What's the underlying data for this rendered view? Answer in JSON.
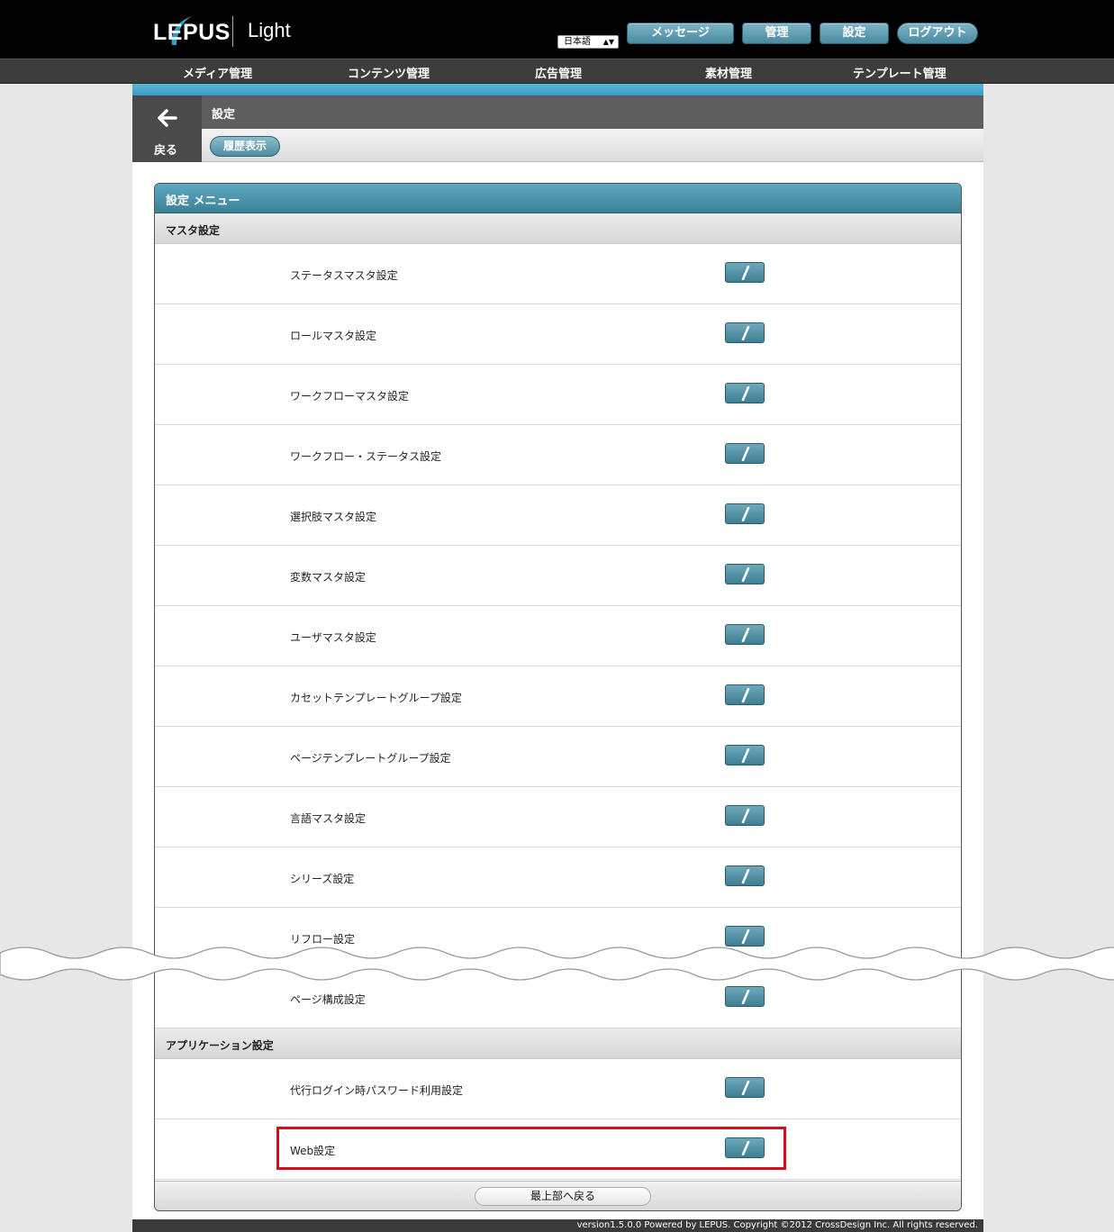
{
  "header": {
    "logo_text": "LEPUS",
    "product_name": "Light",
    "language": "日本語",
    "buttons": [
      "メッセージ",
      "管理",
      "設定",
      "ログアウト"
    ]
  },
  "nav": {
    "items": [
      "メディア管理",
      "コンテンツ管理",
      "広告管理",
      "素材管理",
      "テンプレート管理"
    ]
  },
  "page": {
    "title": "設定",
    "back_label": "戻る",
    "history_button": "履歴表示"
  },
  "menu": {
    "title": "設定 メニュー",
    "sections": [
      {
        "title": "マスタ設定",
        "items": [
          "ステータスマスタ設定",
          "ロールマスタ設定",
          "ワークフローマスタ設定",
          "ワークフロー・ステータス設定",
          "選択肢マスタ設定",
          "変数マスタ設定",
          "ユーザマスタ設定",
          "カセットテンプレートグループ設定",
          "ページテンプレートグループ設定",
          "言語マスタ設定",
          "シリーズ設定",
          "リフロー設定",
          "ページ構成設定"
        ]
      },
      {
        "title": "アプリケーション設定",
        "items": [
          "代行ログイン時パスワード利用設定",
          "Web設定"
        ]
      }
    ],
    "back_to_top": "最上部へ戻る"
  },
  "footer": {
    "text": "version1.5.0.0 Powered by LEPUS. Copyright ©2012 CrossDesign Inc. All rights reserved."
  },
  "colors": {
    "accent": "#3a9ec3",
    "button": "#4a8aa0",
    "highlight": "#d0101c"
  }
}
